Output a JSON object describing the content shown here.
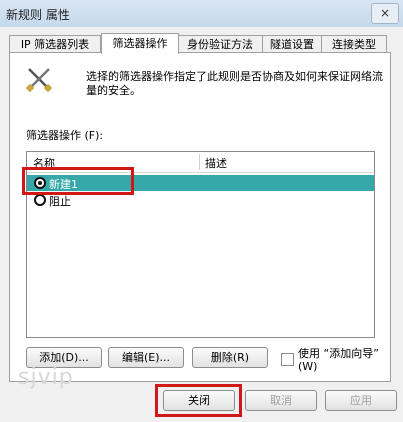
{
  "window": {
    "title": "新规则 属性",
    "close_glyph": "×"
  },
  "tabs": [
    {
      "label": "IP 筛选器列表",
      "active": false
    },
    {
      "label": "筛选器操作",
      "active": true
    },
    {
      "label": "身份验证方法",
      "active": false
    },
    {
      "label": "隧道设置",
      "active": false
    },
    {
      "label": "连接类型",
      "active": false
    }
  ],
  "panel": {
    "icon": "tools-icon",
    "description": "选择的筛选器操作指定了此规则是否协商及如何来保证网络流量的安全。",
    "list_label": "筛选器操作 (F):",
    "columns": [
      "名称",
      "描述"
    ],
    "rows": [
      {
        "name": "新建1",
        "description": "",
        "selected": true
      },
      {
        "name": "阻止",
        "description": "",
        "selected": false
      }
    ],
    "buttons": {
      "add": "添加(D)...",
      "edit": "编辑(E)...",
      "remove": "删除(R)"
    },
    "wizard_checkbox": {
      "label": "使用 “添加向导” (W)",
      "checked": false
    }
  },
  "footer": {
    "close": "关闭",
    "cancel": "取消",
    "apply": "应用"
  },
  "watermark": "sjvip",
  "colors": {
    "selection": "#36a8aa",
    "highlight_box": "#d01818"
  }
}
